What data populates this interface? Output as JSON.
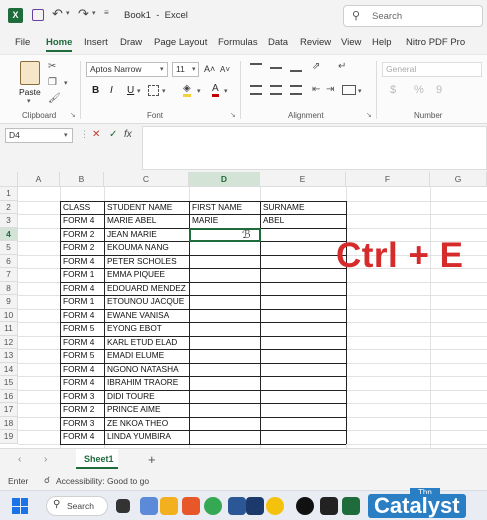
{
  "titlebar": {
    "doc_title": "Book1  -  Excel",
    "search_placeholder": "Search"
  },
  "menu": [
    "File",
    "Home",
    "Insert",
    "Draw",
    "Page Layout",
    "Formulas",
    "Data",
    "Review",
    "View",
    "Help",
    "Nitro PDF Pro"
  ],
  "ribbon": {
    "paste_label": "Paste",
    "clipboard_label": "Clipboard",
    "font_name": "Aptos Narrow",
    "font_size": "11",
    "font_label": "Font",
    "alignment_label": "Alignment",
    "number_format": "General",
    "number_label": "Number",
    "bold": "B",
    "italic": "I",
    "underline": "U",
    "font_color_glyph": "A",
    "grow_glyph": "A˄",
    "shrink_glyph": "A˅",
    "number_icons": [
      "$",
      "%",
      "9"
    ],
    "accent_color": "#1e6b3c",
    "font_color": "#c00000"
  },
  "formula": {
    "name_box": "D4",
    "fx_glyph": "fx",
    "cancel_glyph": "✕",
    "enter_glyph": "✓"
  },
  "columns": [
    "A",
    "B",
    "C",
    "D",
    "E",
    "F",
    "G"
  ],
  "rows": [
    "1",
    "2",
    "3",
    "4",
    "5",
    "6",
    "7",
    "8",
    "9",
    "10",
    "11",
    "12",
    "13",
    "14",
    "15",
    "16",
    "17",
    "18",
    "19"
  ],
  "table": {
    "headers": [
      "CLASS",
      "STUDENT NAME",
      "FIRST NAME",
      "SURNAME"
    ],
    "rows": [
      [
        "FORM 4",
        "MARIE ABEL",
        "MARIE",
        "ABEL"
      ],
      [
        "FORM 2",
        "JEAN MARIE",
        "",
        ""
      ],
      [
        "FORM 2",
        "EKOUMA NANG",
        "",
        ""
      ],
      [
        "FORM 4",
        "PETER SCHOLES",
        "",
        ""
      ],
      [
        "FORM 1",
        "EMMA PIQUEE",
        "",
        ""
      ],
      [
        "FORM 4",
        "EDOUARD MENDEZ",
        "",
        ""
      ],
      [
        "FORM 1",
        "ETOUNOU JACQUE",
        "",
        ""
      ],
      [
        "FORM 4",
        "EWANE VANISA",
        "",
        ""
      ],
      [
        "FORM 5",
        "EYONG EBOT",
        "",
        ""
      ],
      [
        "FORM 4",
        "KARL ETUD ELAD",
        "",
        ""
      ],
      [
        "FORM 5",
        "EMADI ELUME",
        "",
        ""
      ],
      [
        "FORM 4",
        "NGONO NATASHA",
        "",
        ""
      ],
      [
        "FORM 4",
        "IBRAHIM TRAORE",
        "",
        ""
      ],
      [
        "FORM 3",
        "DIDI TOURE",
        "",
        ""
      ],
      [
        "FORM 2",
        "PRINCE AIME",
        "",
        ""
      ],
      [
        "FORM 3",
        "ZE NKOA THEO",
        "",
        ""
      ],
      [
        "FORM 4",
        "LINDA YUMBIRA",
        "",
        ""
      ]
    ]
  },
  "overlay_text": "Ctrl + E",
  "overlay_color": "#d62b2b",
  "sheet_tab": "Sheet1",
  "add_sheet": "+",
  "status": {
    "mode": "Enter",
    "accessibility": "Accessibility: Good to go"
  },
  "taskbar": {
    "search_label": "Search",
    "watermark": "Catalyst",
    "watermark_small": "Thn"
  }
}
